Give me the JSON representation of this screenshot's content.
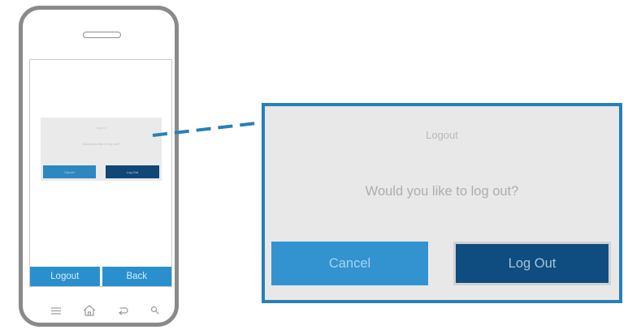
{
  "zoom_dialog": {
    "title": "Logout",
    "message": "Would you like to log out?",
    "cancel_label": "Cancel",
    "logout_label": "Log Out"
  },
  "phone": {
    "bottom_tabs": [
      {
        "label": "Logout"
      },
      {
        "label": "Back"
      }
    ],
    "nav_icons": [
      "menu-icon",
      "home-icon",
      "back-arrow-icon",
      "search-icon"
    ]
  },
  "colors": {
    "phone_frame": "#8a8a8a",
    "tab_blue": "#2a8fcd",
    "cancel_blue": "#3393d0",
    "logout_navy": "#0f4d80",
    "zoom_border": "#2880b8"
  }
}
